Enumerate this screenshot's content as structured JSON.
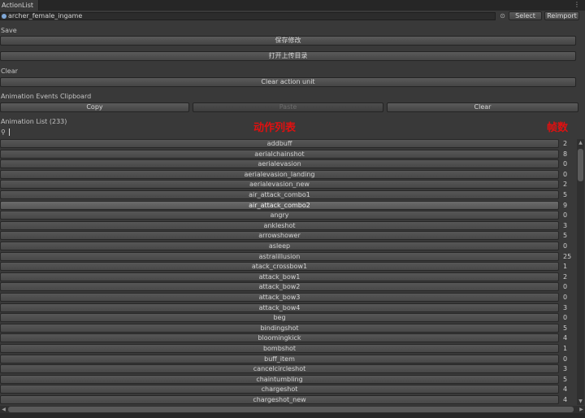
{
  "tab": {
    "title": "ActionList",
    "menu_icon": "⋮"
  },
  "object_field": {
    "value": "archer_female_ingame",
    "select_label": "Select",
    "reimport_label": "Reimport"
  },
  "save": {
    "section_label": "Save",
    "save_changes_label": "保存修改",
    "open_upload_dir_label": "打开上传目录"
  },
  "clear": {
    "section_label": "Clear",
    "clear_action_unit_label": "Clear action unit"
  },
  "clipboard": {
    "section_label": "Animation Events Clipboard",
    "copy_label": "Copy",
    "paste_label": "Paste",
    "clear_label": "Clear"
  },
  "animation_list": {
    "header": "Animation List (233)",
    "annotation_left": "动作列表",
    "annotation_right": "帧数",
    "search_value": "",
    "selected_index": 7,
    "items": [
      {
        "name": "addbuff",
        "count": "2"
      },
      {
        "name": "aerialchainshot",
        "count": "8"
      },
      {
        "name": "aerialevasion",
        "count": "0"
      },
      {
        "name": "aerialevasion_landing",
        "count": "0"
      },
      {
        "name": "aerialevasion_new",
        "count": "2"
      },
      {
        "name": "air_attack_combo1",
        "count": "5"
      },
      {
        "name": "air_attack_combo2",
        "count": "9"
      },
      {
        "name": "angry",
        "count": "0"
      },
      {
        "name": "ankleshot",
        "count": "3"
      },
      {
        "name": "arrowshower",
        "count": "5"
      },
      {
        "name": "asleep",
        "count": "0"
      },
      {
        "name": "astralillusion",
        "count": "25"
      },
      {
        "name": "atack_crossbow1",
        "count": "1"
      },
      {
        "name": "attack_bow1",
        "count": "2"
      },
      {
        "name": "attack_bow2",
        "count": "0"
      },
      {
        "name": "attack_bow3",
        "count": "0"
      },
      {
        "name": "attack_bow4",
        "count": "3"
      },
      {
        "name": "beg",
        "count": "0"
      },
      {
        "name": "bindingshot",
        "count": "5"
      },
      {
        "name": "bloomingkick",
        "count": "4"
      },
      {
        "name": "bombshot",
        "count": "1"
      },
      {
        "name": "buff_item",
        "count": "0"
      },
      {
        "name": "cancelcircleshot",
        "count": "3"
      },
      {
        "name": "chaintumbling",
        "count": "5"
      },
      {
        "name": "chargeshot",
        "count": "4"
      },
      {
        "name": "chargeshot_new",
        "count": "4"
      }
    ]
  }
}
